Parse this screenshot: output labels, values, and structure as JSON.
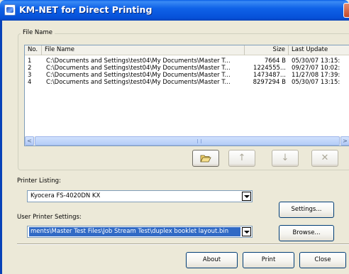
{
  "window": {
    "title": "KM-NET for Direct Printing",
    "icon": "km-net-printer-icon"
  },
  "file_group": {
    "label": "File Name",
    "columns": [
      "No.",
      "File Name",
      "Size",
      "Last Update"
    ],
    "rows": [
      {
        "no": "1",
        "file": "C:\\Documents and Settings\\test04\\My Documents\\Master T...",
        "size": "7664 B",
        "update": "05/30/07 13:15:"
      },
      {
        "no": "2",
        "file": "C:\\Documents and Settings\\test04\\My Documents\\Master T...",
        "size": "1224555...",
        "update": "09/27/07 10:02:"
      },
      {
        "no": "3",
        "file": "C:\\Documents and Settings\\test04\\My Documents\\Master T...",
        "size": "1473487...",
        "update": "11/27/08 17:39:"
      },
      {
        "no": "4",
        "file": "C:\\Documents and Settings\\test04\\My Documents\\Master T...",
        "size": "8297294 B",
        "update": "05/30/07 13:15:"
      }
    ],
    "scroll_left": "<",
    "scroll_right": ">",
    "tool_icons": {
      "open": "folder-open-icon",
      "up": "arrow-up-icon",
      "down": "arrow-down-icon",
      "remove": "x-icon"
    },
    "tool_glyphs": {
      "up": "↑",
      "down": "↓",
      "remove": "✕"
    }
  },
  "printer_listing": {
    "label": "Printer Listing:",
    "value": "Kyocera FS-4020DN KX",
    "settings_button": "Settings..."
  },
  "user_settings": {
    "label": "User Printer Settings:",
    "value": "ments\\Master Test Files\\Job Stream Test\\duplex booklet layout.bin",
    "browse_button": "Browse..."
  },
  "footer": {
    "about": "About",
    "print": "Print",
    "close": "Close"
  }
}
